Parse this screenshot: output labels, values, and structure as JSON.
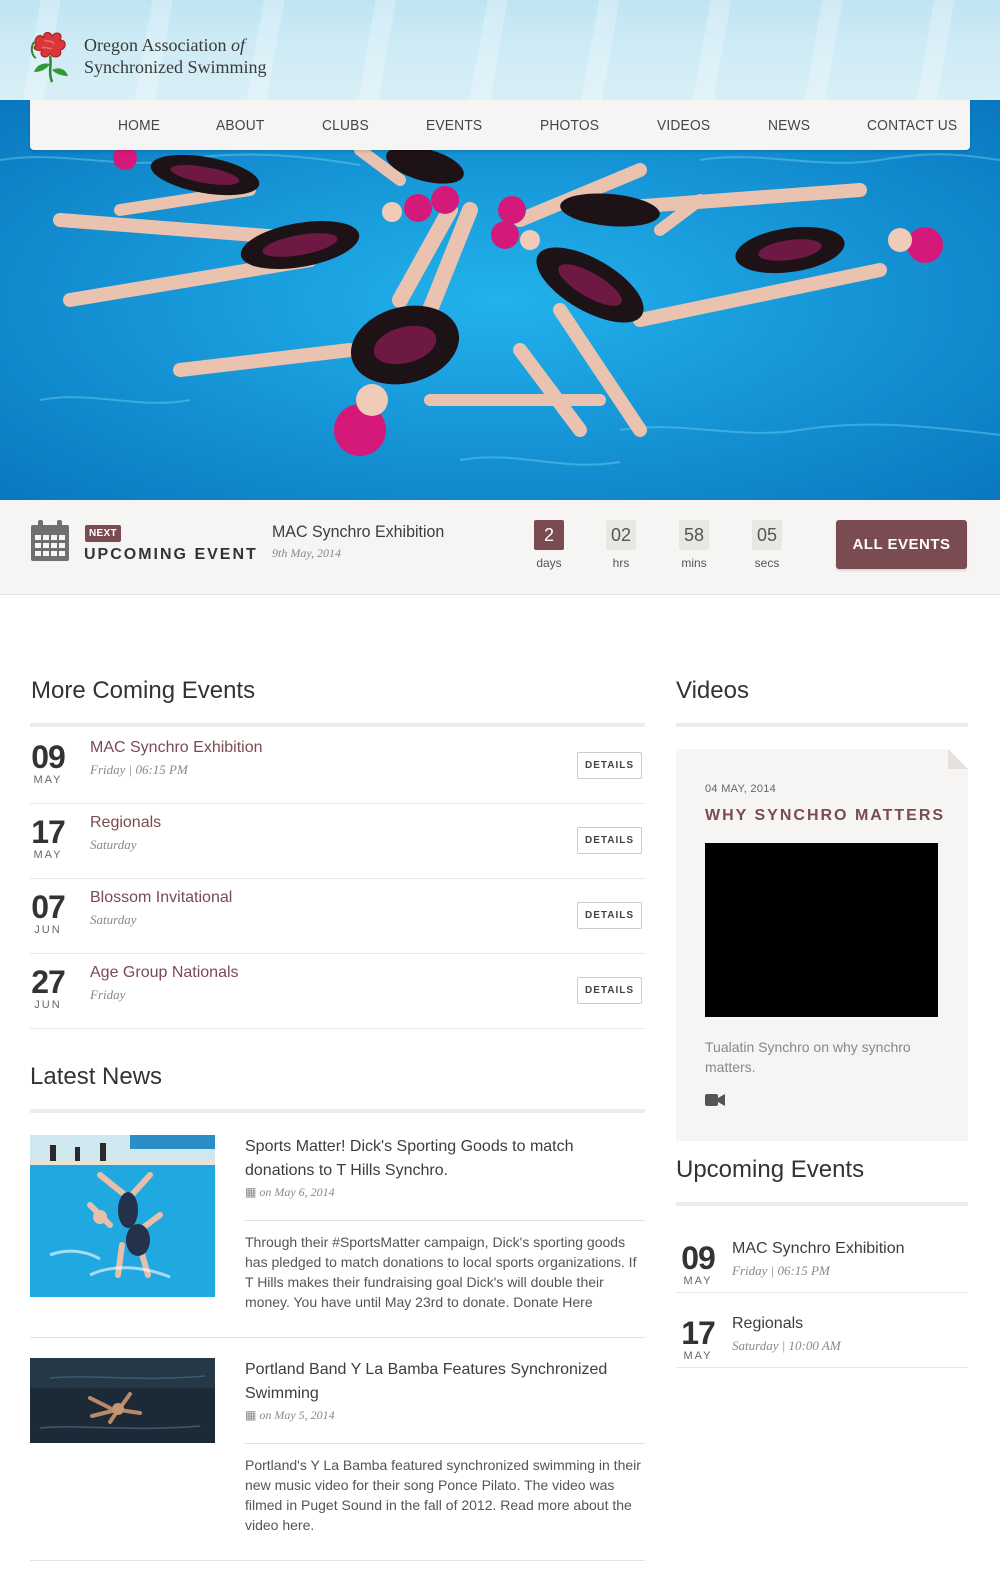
{
  "site": {
    "name_line1": "Oregon Association",
    "name_of": "of",
    "name_line2": "Synchronized Swimming",
    "logo_icon": "rose-logo"
  },
  "nav": {
    "items": [
      "HOME",
      "ABOUT",
      "CLUBS",
      "EVENTS",
      "PHOTOS",
      "VIDEOS",
      "NEWS",
      "CONTACT US"
    ]
  },
  "hero": {
    "image": "synchronized-swimmers-star-formation-photo"
  },
  "countdown": {
    "badge": "NEXT",
    "label": "UPCOMING EVENT",
    "event_title": "MAC Synchro Exhibition",
    "event_date": "9th May, 2014",
    "days": "2",
    "days_label": "days",
    "hrs": "02",
    "hrs_label": "hrs",
    "mins": "58",
    "mins_label": "mins",
    "secs": "05",
    "secs_label": "secs",
    "button": "ALL EVENTS"
  },
  "more_events": {
    "title": "More Coming Events",
    "details_label": "DETAILS",
    "items": [
      {
        "day": "09",
        "month": "MAY",
        "title": "MAC Synchro Exhibition",
        "when": "Friday | 06:15 PM"
      },
      {
        "day": "17",
        "month": "MAY",
        "title": "Regionals",
        "when": "Saturday"
      },
      {
        "day": "07",
        "month": "JUN",
        "title": "Blossom Invitational",
        "when": "Saturday"
      },
      {
        "day": "27",
        "month": "JUN",
        "title": "Age Group Nationals",
        "when": "Friday"
      }
    ]
  },
  "news": {
    "title": "Latest News",
    "items": [
      {
        "title": "Sports Matter! Dick's Sporting Goods to match donations to T Hills Synchro.",
        "date": "on May 6, 2014",
        "body": "Through their #SportsMatter campaign, Dick's sporting goods has pledged to match donations to local sports organizations.  If T Hills makes their fundraising goal Dick's will double their money. You have until May 23rd to donate. Donate Here"
      },
      {
        "title": "Portland Band Y La Bamba Features Synchronized Swimming",
        "date": "on May 5, 2014",
        "body": "Portland's Y La Bamba featured synchronized swimming in their new music video for their song Ponce Pilato.  The video was filmed in Puget Sound in the fall of 2012.  Read more about the video here."
      }
    ]
  },
  "videos": {
    "title": "Videos",
    "date": "04 MAY, 2014",
    "video_title": "WHY SYNCHRO MATTERS",
    "description": "Tualatin Synchro on why synchro matters.",
    "icon": "video-camera-icon"
  },
  "sidebar_upcoming": {
    "title": "Upcoming Events",
    "items": [
      {
        "day": "09",
        "month": "MAY",
        "title": "MAC Synchro Exhibition",
        "when": "Friday | 06:15 PM"
      },
      {
        "day": "17",
        "month": "MAY",
        "title": "Regionals",
        "when": "Saturday | 10:00 AM"
      }
    ]
  },
  "colors": {
    "accent": "#7a4b50",
    "panel": "#f6f5f3",
    "pool": "#1aa7e6"
  }
}
